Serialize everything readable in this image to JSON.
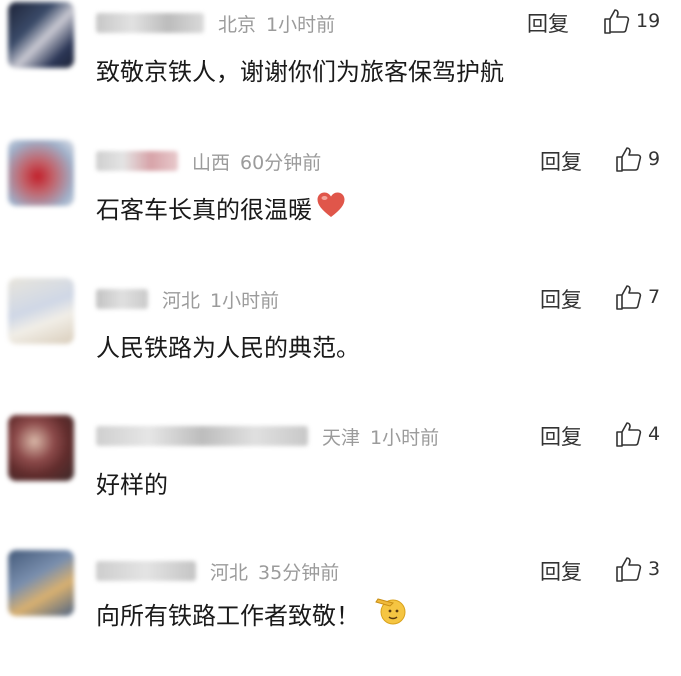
{
  "comments": [
    {
      "region": "北京",
      "time": "1小时前",
      "text": "致敬京铁人，谢谢你们为旅客保驾护航",
      "emoji": "",
      "reply_label": "回复",
      "likes": "19",
      "avatar_colors": [
        "#3a4a68",
        "#c9c9d2",
        "#1e2438"
      ]
    },
    {
      "region": "山西",
      "time": "60分钟前",
      "text": "石客车长真的很温暖",
      "emoji": "heart-emoji",
      "reply_label": "回复",
      "likes": "9",
      "avatar_colors": [
        "#c2626a",
        "#9fb0c9",
        "#c21f2a"
      ]
    },
    {
      "region": "河北",
      "time": "1小时前",
      "text": "人民铁路为人民的典范。",
      "emoji": "",
      "reply_label": "回复",
      "likes": "7",
      "avatar_colors": [
        "#e8e5dc",
        "#cfd7e6",
        "#d9cdbb"
      ]
    },
    {
      "region": "天津",
      "time": "1小时前",
      "text": "好样的",
      "emoji": "",
      "reply_label": "回复",
      "likes": "4",
      "avatar_colors": [
        "#3b2a2a",
        "#d9b8a8",
        "#612c2c"
      ]
    },
    {
      "region": "河北",
      "time": "35分钟前",
      "text": "向所有铁路工作者致敬！",
      "emoji": "salute-emoji",
      "reply_label": "回复",
      "likes": "3",
      "avatar_colors": [
        "#7a8fae",
        "#d8b070",
        "#445a7a"
      ]
    }
  ]
}
